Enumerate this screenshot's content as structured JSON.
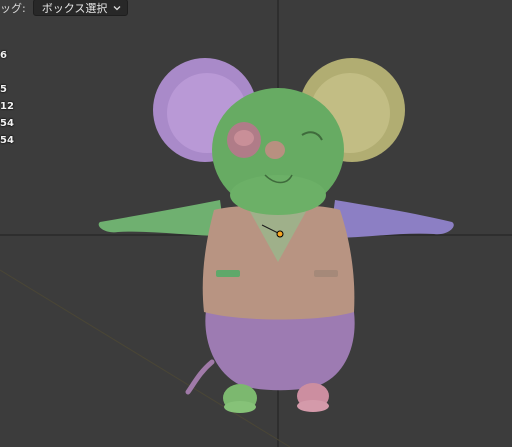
{
  "header": {
    "drag_label": "ッグ:",
    "select_mode_value": "ボックス選択"
  },
  "stats": {
    "lines": [
      "6",
      "",
      "5",
      "12",
      "54",
      "54"
    ]
  },
  "icons": {
    "dropdown_chevron": "chevron-down-icon",
    "object_origin": "origin-dot-icon"
  },
  "colors": {
    "viewport_bg": "#3c3c3c",
    "grid_line": "#2a2a2a",
    "origin_dot": "#f5a623"
  }
}
